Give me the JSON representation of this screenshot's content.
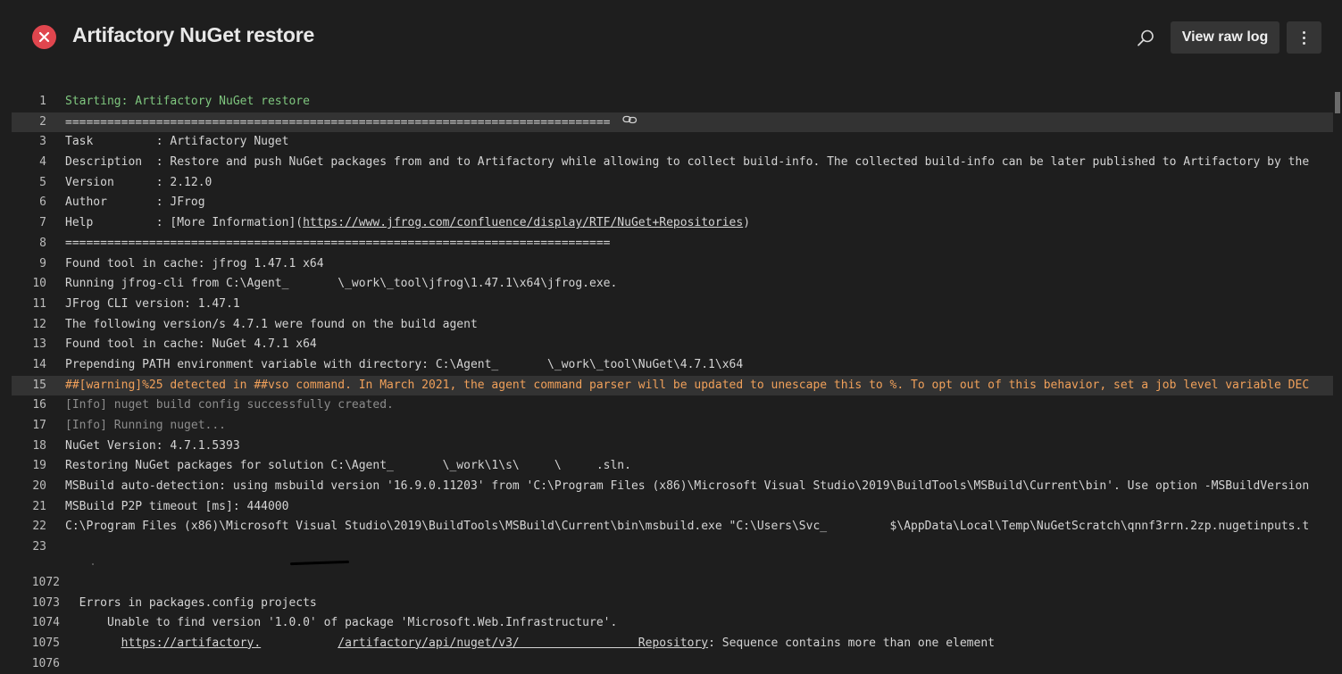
{
  "header": {
    "title": "Artifactory NuGet restore",
    "status_icon": "error-icon",
    "status_color": "#e0464e",
    "search_icon": "search-icon",
    "view_raw_log_label": "View raw log",
    "more_icon": "more-vertical-icon"
  },
  "log": [
    {
      "num": "1",
      "text": "Starting: Artifactory NuGet restore",
      "style": "green"
    },
    {
      "num": "2",
      "text": "==============================================================================",
      "style": "normal",
      "highlight": true,
      "link_icon": true
    },
    {
      "num": "3",
      "text": "Task         : Artifactory Nuget",
      "style": "normal"
    },
    {
      "num": "4",
      "text": "Description  : Restore and push NuGet packages from and to Artifactory while allowing to collect build-info. The collected build-info can be later published to Artifactory by the",
      "style": "normal"
    },
    {
      "num": "5",
      "text": "Version      : 2.12.0",
      "style": "normal"
    },
    {
      "num": "6",
      "text": "Author       : JFrog",
      "style": "normal"
    },
    {
      "num": "7",
      "prefix": "Help         : [More Information](",
      "link": "https://www.jfrog.com/confluence/display/RTF/NuGet+Repositories",
      "suffix": ")",
      "style": "normal"
    },
    {
      "num": "8",
      "text": "==============================================================================",
      "style": "normal"
    },
    {
      "num": "9",
      "text": "Found tool in cache: jfrog 1.47.1 x64",
      "style": "normal"
    },
    {
      "num": "10",
      "text": "Running jfrog-cli from C:\\Agent_       \\_work\\_tool\\jfrog\\1.47.1\\x64\\jfrog.exe.",
      "style": "normal"
    },
    {
      "num": "11",
      "text": "JFrog CLI version: 1.47.1",
      "style": "normal"
    },
    {
      "num": "12",
      "text": "The following version/s 4.7.1 were found on the build agent",
      "style": "normal"
    },
    {
      "num": "13",
      "text": "Found tool in cache: NuGet 4.7.1 x64",
      "style": "normal"
    },
    {
      "num": "14",
      "text": "Prepending PATH environment variable with directory: C:\\Agent_       \\_work\\_tool\\NuGet\\4.7.1\\x64",
      "style": "normal"
    },
    {
      "num": "15",
      "text": "##[warning]%25 detected in ##vso command. In March 2021, the agent command parser will be updated to unescape this to %. To opt out of this behavior, set a job level variable DEC",
      "style": "orange",
      "highlight": true
    },
    {
      "num": "16",
      "text": "[Info] nuget build config successfully created.",
      "style": "gray"
    },
    {
      "num": "17",
      "text": "[Info] Running nuget...",
      "style": "gray"
    },
    {
      "num": "18",
      "text": "NuGet Version: 4.7.1.5393",
      "style": "normal"
    },
    {
      "num": "19",
      "text": "Restoring NuGet packages for solution C:\\Agent_       \\_work\\1\\s\\     \\     .sln.",
      "style": "normal"
    },
    {
      "num": "20",
      "text": "MSBuild auto-detection: using msbuild version '16.9.0.11203' from 'C:\\Program Files (x86)\\Microsoft Visual Studio\\2019\\BuildTools\\MSBuild\\Current\\bin'. Use option -MSBuildVersion",
      "style": "normal"
    },
    {
      "num": "21",
      "text": "MSBuild P2P timeout [ms]: 444000",
      "style": "normal"
    },
    {
      "num": "22",
      "text": "C:\\Program Files (x86)\\Microsoft Visual Studio\\2019\\BuildTools\\MSBuild\\Current\\bin\\msbuild.exe \"C:\\Users\\Svc_         $\\AppData\\Local\\Temp\\NuGetScratch\\qnnf3rrn.2zp.nugetinputs.t",
      "style": "normal"
    },
    {
      "num": "23",
      "text": "",
      "style": "normal"
    }
  ],
  "log_tail": [
    {
      "num": "1072",
      "text": "",
      "style": "normal"
    },
    {
      "num": "1073",
      "text": "  Errors in packages.config projects",
      "style": "normal"
    },
    {
      "num": "1074",
      "text": "      Unable to find version '1.0.0' of package 'Microsoft.Web.Infrastructure'.",
      "style": "normal"
    },
    {
      "num": "1075",
      "prefix": "        ",
      "link": "https://artifactory.",
      "mid": "           ",
      "link2": "/artifactory/api/nuget/v3/                 Repository",
      "suffix": ": Sequence contains more than one element",
      "style": "normal"
    },
    {
      "num": "1076",
      "text": "",
      "style": "normal"
    }
  ]
}
